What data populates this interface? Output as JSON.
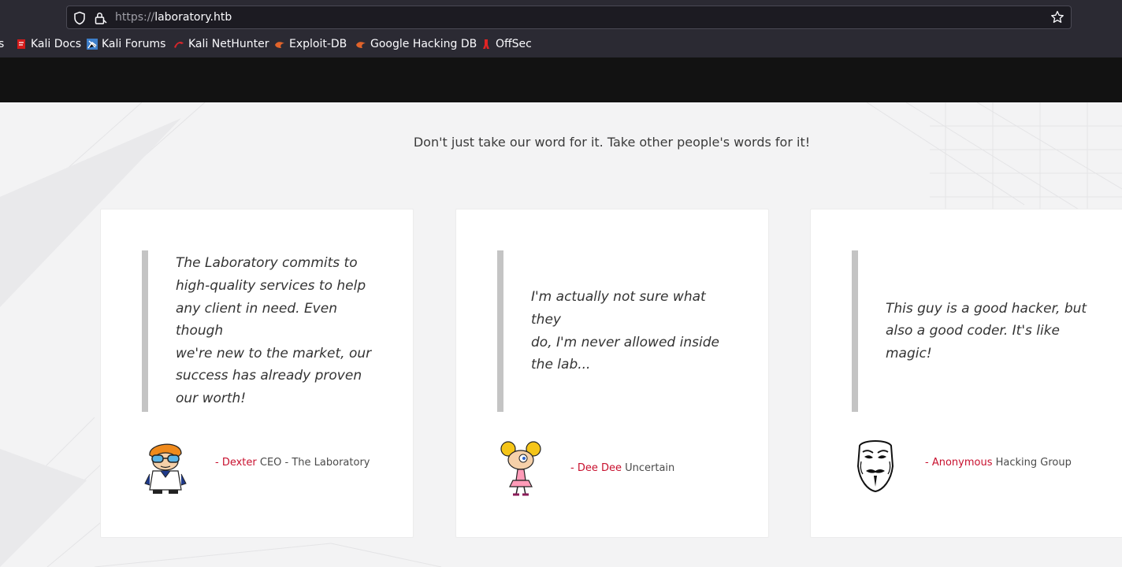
{
  "browser": {
    "url_scheme": "https://",
    "url_host": "laboratory.htb",
    "bookmarks": [
      {
        "label": "s",
        "icon": "none"
      },
      {
        "label": "Kali Docs",
        "icon": "kali-docs-icon"
      },
      {
        "label": "Kali Forums",
        "icon": "kali-forums-icon"
      },
      {
        "label": "Kali NetHunter",
        "icon": "kali-nethunter-icon"
      },
      {
        "label": "Exploit-DB",
        "icon": "exploit-db-icon"
      },
      {
        "label": "Google Hacking DB",
        "icon": "ghdb-icon"
      },
      {
        "label": "OffSec",
        "icon": "offsec-icon"
      }
    ]
  },
  "testimonials": {
    "subtitle": "Don't just take our word for it. Take other people's words for it!",
    "items": [
      {
        "quote_lines": [
          "The Laboratory commits to",
          "high-quality services to help",
          "any client in need. Even though",
          "we're new to the market, our",
          "success has already proven",
          "our worth!"
        ],
        "dash": "- ",
        "name": "Dexter",
        "role": " CEO - The Laboratory",
        "avatar": "dexter-avatar"
      },
      {
        "quote_lines": [
          "I'm actually not sure what they",
          "do, I'm never allowed inside",
          "the lab..."
        ],
        "dash": "- ",
        "name": "Dee Dee",
        "role": " Uncertain",
        "avatar": "dee-dee-avatar"
      },
      {
        "quote_lines": [
          "This guy is a good hacker, but",
          "also a good coder. It's like",
          "magic!"
        ],
        "dash": "- ",
        "name": "Anonymous",
        "role": " Hacking Group",
        "avatar": "anonymous-mask-avatar"
      }
    ]
  },
  "colors": {
    "accent": "#c8102e",
    "nav_bg": "#121212",
    "chrome_bg": "#2b2a33",
    "page_bg": "#f3f3f4"
  }
}
